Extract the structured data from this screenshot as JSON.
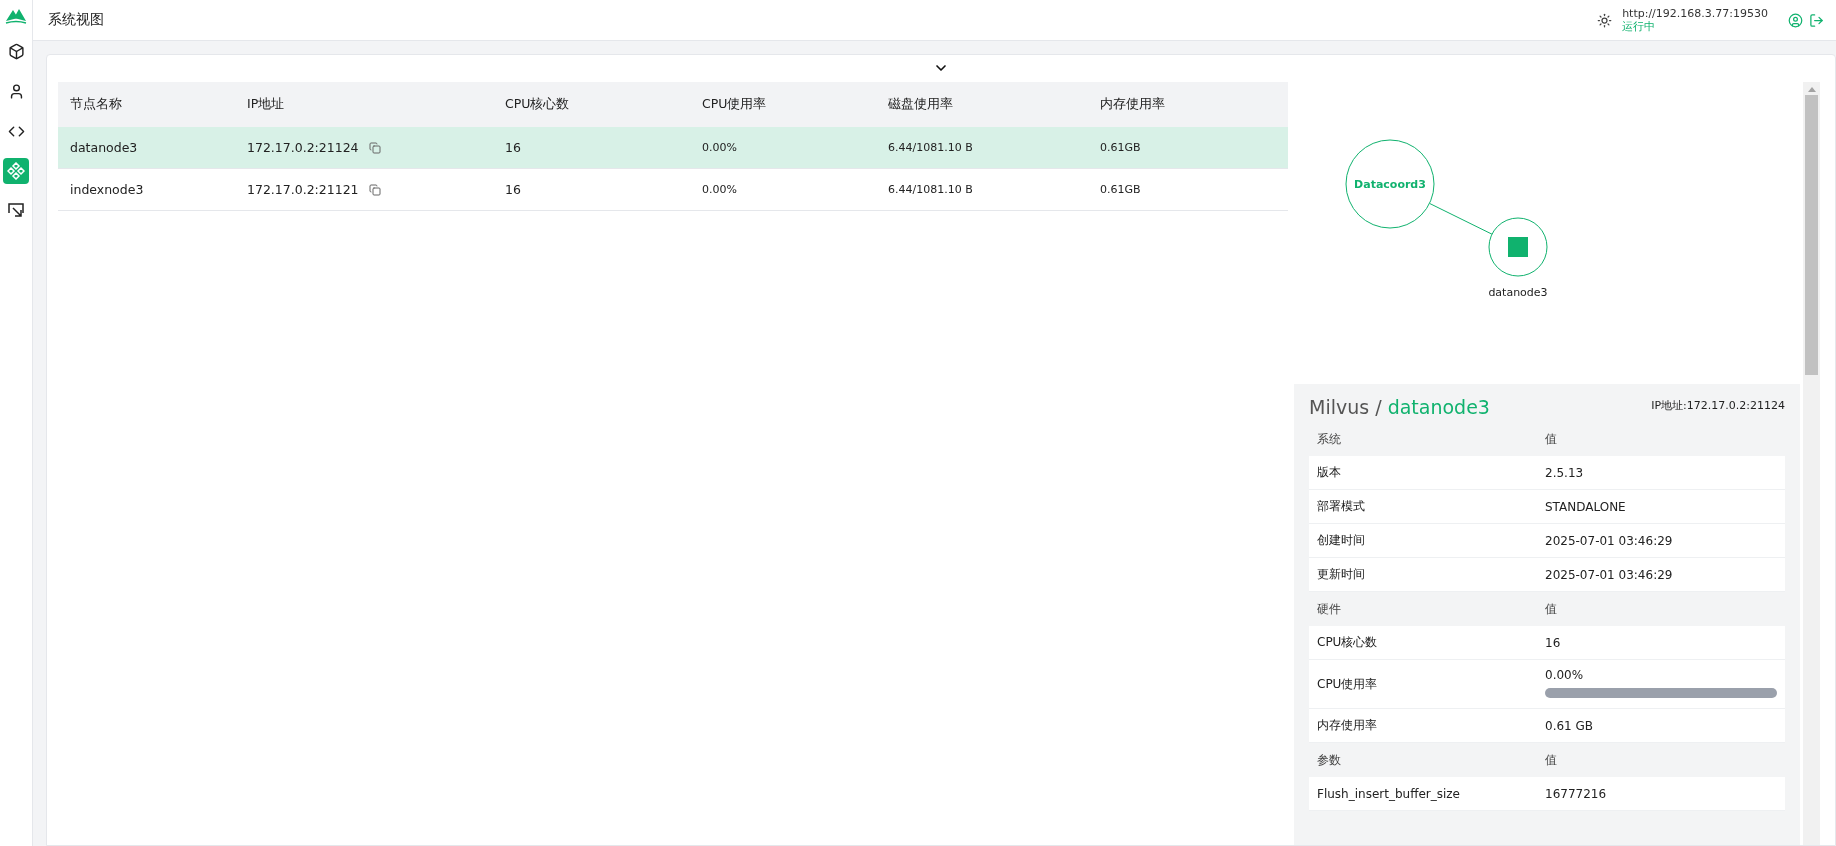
{
  "sidebar": {
    "items": [
      {
        "selected": false
      },
      {
        "selected": false
      },
      {
        "selected": false
      },
      {
        "selected": true
      },
      {
        "selected": false
      }
    ]
  },
  "header": {
    "title": "系统视图",
    "url": "http://192.168.3.77:19530",
    "status": "运行中"
  },
  "table": {
    "columns": [
      "节点名称",
      "IP地址",
      "CPU核心数",
      "CPU使用率",
      "磁盘使用率",
      "内存使用率"
    ],
    "rows": [
      {
        "selected": true,
        "cells": [
          "datanode3",
          "172.17.0.2:21124",
          "16",
          "0.00%",
          "6.44/1081.10 B",
          "0.61GB"
        ]
      },
      {
        "selected": false,
        "cells": [
          "indexnode3",
          "172.17.0.2:21121",
          "16",
          "0.00%",
          "6.44/1081.10 B",
          "0.61GB"
        ]
      }
    ]
  },
  "graph": {
    "center": "Datacoord3",
    "nodes": [
      {
        "label": "datanode3"
      }
    ]
  },
  "detail": {
    "brand": "Milvus",
    "separator": "/",
    "node": "datanode3",
    "ip": "IP地址:172.17.0.2:21124",
    "sections": [
      {
        "heading": "系统",
        "value_heading": "值",
        "rows": [
          {
            "kind": "text",
            "label": "版本",
            "value": "2.5.13"
          },
          {
            "kind": "text",
            "label": "部署模式",
            "value": "STANDALONE"
          },
          {
            "kind": "text",
            "label": "创建时间",
            "value": "2025-07-01 03:46:29"
          },
          {
            "kind": "text",
            "label": "更新时间",
            "value": "2025-07-01 03:46:29"
          }
        ]
      },
      {
        "heading": "硬件",
        "value_heading": "值",
        "rows": [
          {
            "kind": "text",
            "label": "CPU核心数",
            "value": "16"
          },
          {
            "kind": "meter",
            "label": "CPU使用率",
            "value": "0.00%",
            "level": 0
          },
          {
            "kind": "text",
            "label": "内存使用率",
            "value": "0.61 GB"
          }
        ]
      },
      {
        "heading": "参数",
        "value_heading": "值",
        "rows": [
          {
            "kind": "text",
            "label": "Flush_insert_buffer_size",
            "value": "16777216"
          }
        ]
      }
    ]
  }
}
